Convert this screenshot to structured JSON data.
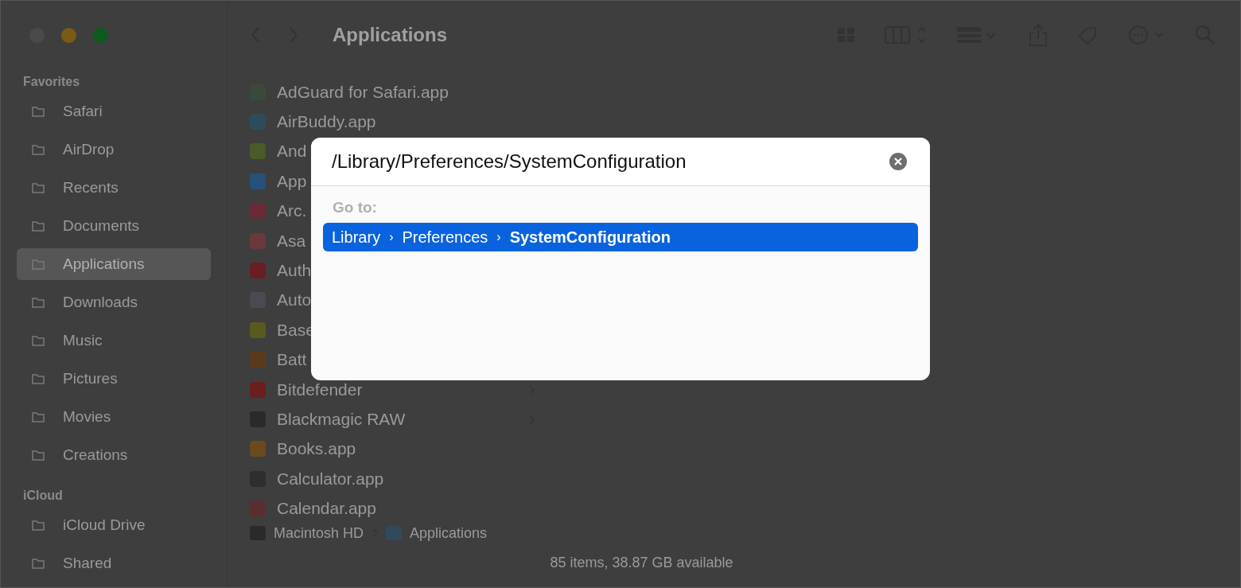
{
  "window": {
    "title": "Applications",
    "traffic_lights": [
      {
        "color": "#4a4a4a"
      },
      {
        "color": "#7a5a14"
      },
      {
        "color": "#0d5a1c"
      }
    ]
  },
  "sidebar": {
    "sections": [
      {
        "header": "Favorites",
        "items": [
          {
            "label": "Safari",
            "selected": false
          },
          {
            "label": "AirDrop",
            "selected": false
          },
          {
            "label": "Recents",
            "selected": false
          },
          {
            "label": "Documents",
            "selected": false
          },
          {
            "label": "Applications",
            "selected": true
          },
          {
            "label": "Downloads",
            "selected": false
          },
          {
            "label": "Music",
            "selected": false
          },
          {
            "label": "Pictures",
            "selected": false
          },
          {
            "label": "Movies",
            "selected": false
          },
          {
            "label": "Creations",
            "selected": false
          }
        ]
      },
      {
        "header": "iCloud",
        "items": [
          {
            "label": "iCloud Drive",
            "selected": false
          },
          {
            "label": "Shared",
            "selected": false
          }
        ]
      }
    ]
  },
  "files": [
    {
      "name": "AdGuard for Safari.app",
      "kind": "app",
      "color": "#3a4a3a"
    },
    {
      "name": "AirBuddy.app",
      "kind": "app",
      "color": "#2f4a5c"
    },
    {
      "name": "And",
      "kind": "app",
      "color": "#4a5a2a"
    },
    {
      "name": "App",
      "kind": "app",
      "color": "#27507a"
    },
    {
      "name": "Arc.",
      "kind": "app",
      "color": "#6a2a36"
    },
    {
      "name": "Asa",
      "kind": "app",
      "color": "#6a3a3a"
    },
    {
      "name": "Auth",
      "kind": "app",
      "color": "#6a1e24"
    },
    {
      "name": "Auto",
      "kind": "app",
      "color": "#4a4a52"
    },
    {
      "name": "Base",
      "kind": "app",
      "color": "#5a5a1e"
    },
    {
      "name": "Batt",
      "kind": "app",
      "color": "#5a3a1e"
    },
    {
      "name": "Bitdefender",
      "kind": "folder",
      "color": "#6a1e1e"
    },
    {
      "name": "Blackmagic RAW",
      "kind": "folder",
      "color": "#2a2a2a"
    },
    {
      "name": "Books.app",
      "kind": "app",
      "color": "#6a4a1e"
    },
    {
      "name": "Calculator.app",
      "kind": "app",
      "color": "#2e2e2e"
    },
    {
      "name": "Calendar.app",
      "kind": "app",
      "color": "#5a2e2e"
    }
  ],
  "path_bar": [
    "Macintosh HD",
    "Applications"
  ],
  "status_bar": "85 items, 38.87 GB available",
  "goto_dialog": {
    "value": "/Library/Preferences/SystemConfiguration",
    "section_label": "Go to:",
    "suggestions": [
      {
        "selected": true,
        "parts": [
          {
            "kind": "segment",
            "text": "Library",
            "current": false
          },
          {
            "kind": "separator",
            "text": "›"
          },
          {
            "kind": "segment",
            "text": "Preferences",
            "current": false
          },
          {
            "kind": "separator",
            "text": "›"
          },
          {
            "kind": "segment",
            "text": "SystemConfiguration",
            "current": true
          }
        ]
      }
    ]
  }
}
